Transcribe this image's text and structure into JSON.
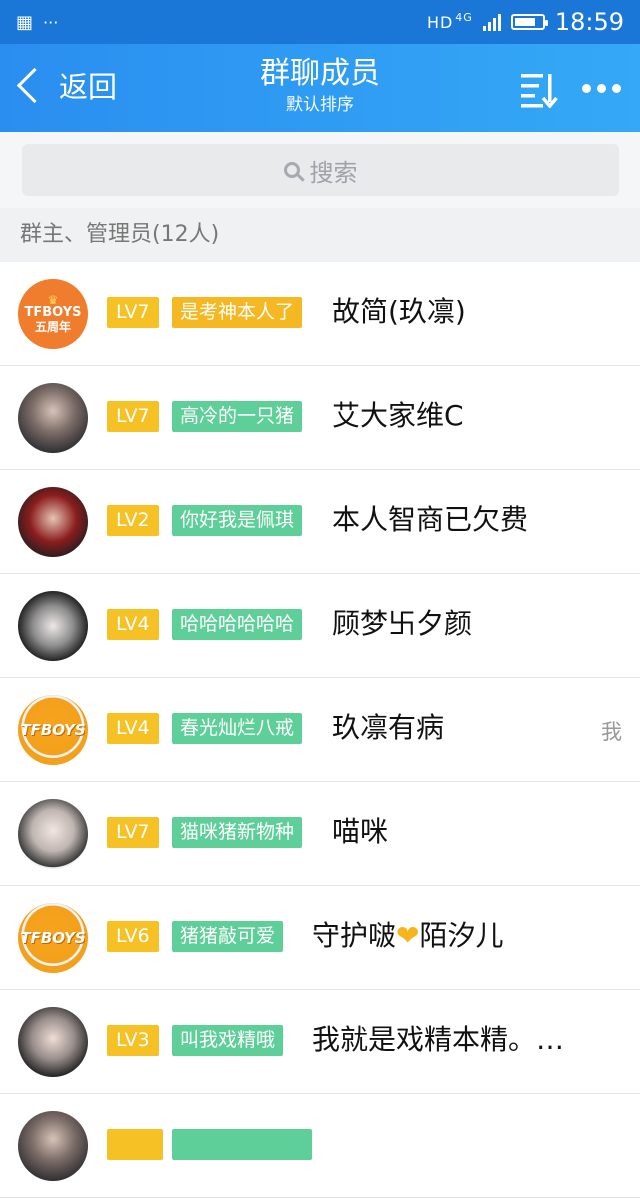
{
  "status_bar": {
    "network": "HD",
    "network_gen": "4G",
    "time": "18:59"
  },
  "header": {
    "back_label": "返回",
    "title": "群聊成员",
    "subtitle": "默认排序"
  },
  "search": {
    "placeholder": "搜索"
  },
  "section": {
    "label": "群主、管理员(12人)"
  },
  "members": [
    {
      "avatar_text": "TFBOYS",
      "avatar_sub": "五周年",
      "level": "LV7",
      "title": "是考神本人了",
      "name": "故简(玖凛)"
    },
    {
      "level": "LV7",
      "title": "高冷的一只猪",
      "name": "艾大家维C"
    },
    {
      "level": "LV2",
      "title": "你好我是佩琪",
      "name": "本人智商已欠费"
    },
    {
      "level": "LV4",
      "title": "哈哈哈哈哈哈",
      "name": "顾梦卐夕颜"
    },
    {
      "avatar_text": "TFBOYS",
      "level": "LV4",
      "title": "春光灿烂八戒",
      "name": "玖凛有病",
      "me_label": "我"
    },
    {
      "level": "LV7",
      "title": "猫咪猪新物种",
      "name": "喵咪"
    },
    {
      "avatar_text": "TFBOYS",
      "level": "LV6",
      "title": "猪猪敲可爱",
      "name_parts": [
        "守护啵",
        "❤",
        "陌汐儿"
      ]
    },
    {
      "level": "LV3",
      "title": "叫我戏精哦",
      "name": "我就是戏精本精。…"
    }
  ]
}
